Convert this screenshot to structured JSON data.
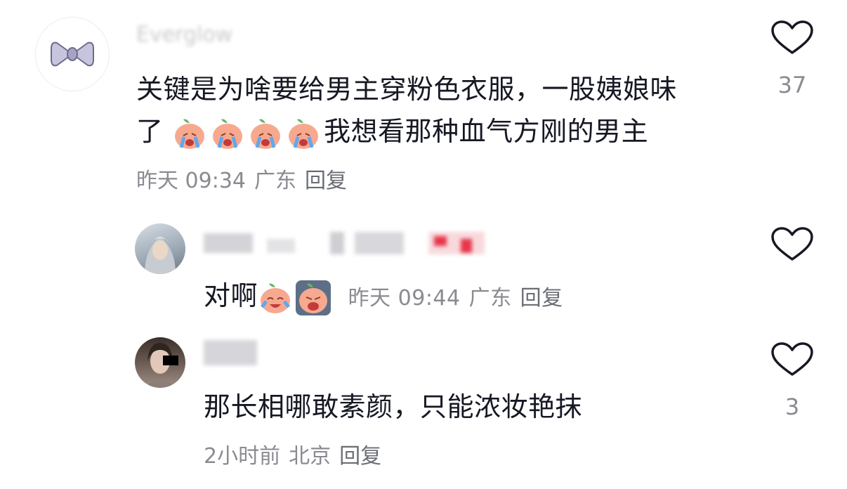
{
  "comments": [
    {
      "username": "Everglow",
      "text_line1": "关键是为啥要给男主穿粉色衣服，一股姨娘味",
      "text_line2_prefix": "了",
      "text_line2_suffix": "我想看那种血气方刚的男主",
      "emojis": [
        "crying-peach-emoji",
        "crying-peach-emoji",
        "crying-peach-emoji",
        "crying-peach-emoji"
      ],
      "time": "昨天 09:34",
      "location": "广东",
      "reply_label": "回复",
      "likes": "37"
    },
    {
      "username": "",
      "text": "对啊",
      "emojis": [
        "laughing-crying-peach-emoji",
        "crying-peach-emoji"
      ],
      "time": "昨天 09:44",
      "location": "广东",
      "reply_label": "回复",
      "likes": ""
    },
    {
      "username": "",
      "text": "那长相哪敢素颜，只能浓妆艳抹",
      "time": "2小时前",
      "location": "北京",
      "reply_label": "回复",
      "likes": "3"
    }
  ],
  "colors": {
    "text": "#161823",
    "meta": "#8a8b91",
    "heart": "#161823",
    "emoji_peach": "#f7a98f",
    "emoji_tear": "#5fa8ef"
  },
  "icons": {
    "like": "heart-outline-icon"
  }
}
